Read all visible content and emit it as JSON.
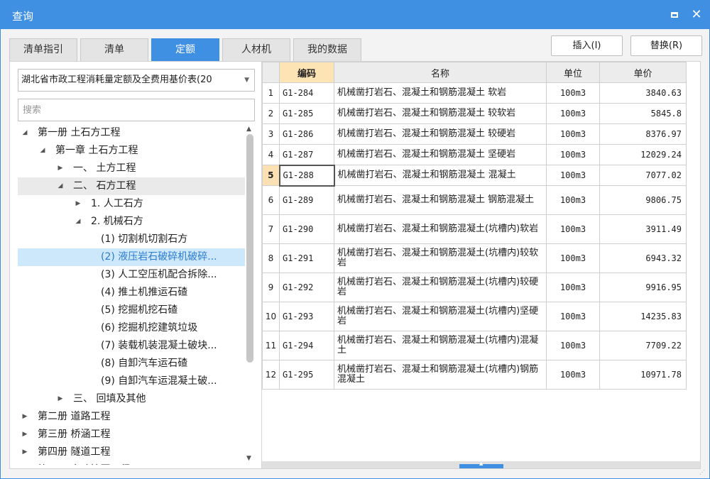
{
  "window": {
    "title": "查询"
  },
  "tabs": [
    {
      "label": "清单指引"
    },
    {
      "label": "清单"
    },
    {
      "label": "定额"
    },
    {
      "label": "人材机"
    },
    {
      "label": "我的数据"
    }
  ],
  "actions": {
    "insert_label": "插入(I)",
    "replace_label": "替换(R)"
  },
  "library": {
    "selected": "湖北省市政工程消耗量定额及全费用基价表(20"
  },
  "search": {
    "placeholder": "搜索",
    "value": ""
  },
  "tree": [
    {
      "label": "第一册 土石方工程",
      "level": 0,
      "toggle": "expanded"
    },
    {
      "label": "第一章 土石方工程",
      "level": 1,
      "toggle": "expanded"
    },
    {
      "label": "一、 土方工程",
      "level": 2,
      "toggle": "collapsed"
    },
    {
      "label": "二、 石方工程",
      "level": 2,
      "toggle": "expanded",
      "state": "hover"
    },
    {
      "label": "1. 人工石方",
      "level": 3,
      "toggle": "collapsed"
    },
    {
      "label": "2. 机械石方",
      "level": 3,
      "toggle": "expanded"
    },
    {
      "label": "(1) 切割机切割石方",
      "level": 4,
      "toggle": "none"
    },
    {
      "label": "(2) 液压岩石破碎机破碎...",
      "level": 4,
      "toggle": "none",
      "state": "selected"
    },
    {
      "label": "(3) 人工空压机配合拆除...",
      "level": 4,
      "toggle": "none"
    },
    {
      "label": "(4) 推土机推运石碴",
      "level": 4,
      "toggle": "none"
    },
    {
      "label": "(5) 挖掘机挖石碴",
      "level": 4,
      "toggle": "none"
    },
    {
      "label": "(6) 挖掘机挖建筑垃圾",
      "level": 4,
      "toggle": "none"
    },
    {
      "label": "(7) 装载机装混凝土破块...",
      "level": 4,
      "toggle": "none"
    },
    {
      "label": "(8) 自卸汽车运石碴",
      "level": 4,
      "toggle": "none"
    },
    {
      "label": "(9) 自卸汽车运混凝土破...",
      "level": 4,
      "toggle": "none"
    },
    {
      "label": "三、 回填及其他",
      "level": 2,
      "toggle": "collapsed"
    },
    {
      "label": "第二册 道路工程",
      "level": 0,
      "toggle": "collapsed"
    },
    {
      "label": "第三册 桥涵工程",
      "level": 0,
      "toggle": "collapsed"
    },
    {
      "label": "第四册 隧道工程",
      "level": 0,
      "toggle": "collapsed"
    },
    {
      "label": "第五册 市政管网工程",
      "level": 0,
      "toggle": "collapsed"
    }
  ],
  "grid": {
    "columns": {
      "code": "编码",
      "name": "名称",
      "unit": "单位",
      "price": "单价"
    },
    "current_row": 5,
    "rows": [
      {
        "no": "1",
        "code": "G1-284",
        "name": "机械凿打岩石、混凝土和钢筋混凝土 软岩",
        "unit": "100m3",
        "price": "3840.63"
      },
      {
        "no": "2",
        "code": "G1-285",
        "name": "机械凿打岩石、混凝土和钢筋混凝土 较软岩",
        "unit": "100m3",
        "price": "5845.8"
      },
      {
        "no": "3",
        "code": "G1-286",
        "name": "机械凿打岩石、混凝土和钢筋混凝土 较硬岩",
        "unit": "100m3",
        "price": "8376.97"
      },
      {
        "no": "4",
        "code": "G1-287",
        "name": "机械凿打岩石、混凝土和钢筋混凝土 坚硬岩",
        "unit": "100m3",
        "price": "12029.24"
      },
      {
        "no": "5",
        "code": "G1-288",
        "name": "机械凿打岩石、混凝土和钢筋混凝土 混凝土",
        "unit": "100m3",
        "price": "7077.02"
      },
      {
        "no": "6",
        "code": "G1-289",
        "name": "机械凿打岩石、混凝土和钢筋混凝土 钢筋混凝土",
        "unit": "100m3",
        "price": "9806.75"
      },
      {
        "no": "7",
        "code": "G1-290",
        "name": "机械凿打岩石、混凝土和钢筋混凝土(坑槽内)软岩",
        "unit": "100m3",
        "price": "3911.49"
      },
      {
        "no": "8",
        "code": "G1-291",
        "name": "机械凿打岩石、混凝土和钢筋混凝土(坑槽内)较软岩",
        "unit": "100m3",
        "price": "6943.32"
      },
      {
        "no": "9",
        "code": "G1-292",
        "name": "机械凿打岩石、混凝土和钢筋混凝土(坑槽内)较硬岩",
        "unit": "100m3",
        "price": "9916.95"
      },
      {
        "no": "10",
        "code": "G1-293",
        "name": "机械凿打岩石、混凝土和钢筋混凝土(坑槽内)坚硬岩",
        "unit": "100m3",
        "price": "14235.83"
      },
      {
        "no": "11",
        "code": "G1-294",
        "name": "机械凿打岩石、混凝土和钢筋混凝土(坑槽内)混凝土",
        "unit": "100m3",
        "price": "7709.22"
      },
      {
        "no": "12",
        "code": "G1-295",
        "name": "机械凿打岩石、混凝土和钢筋混凝土(坑槽内)钢筋混凝土",
        "unit": "100m3",
        "price": "10971.78"
      }
    ]
  },
  "icons": {
    "maximize": "maximize-icon",
    "close": "close-icon",
    "dropdown": "chevron-down-icon",
    "expanded": "triangle-down-icon",
    "collapsed": "triangle-right-icon"
  },
  "colors": {
    "accent": "#3f8fe3",
    "selected_row": "#cde8fb",
    "current_row_marker": "#fbe0b4"
  }
}
